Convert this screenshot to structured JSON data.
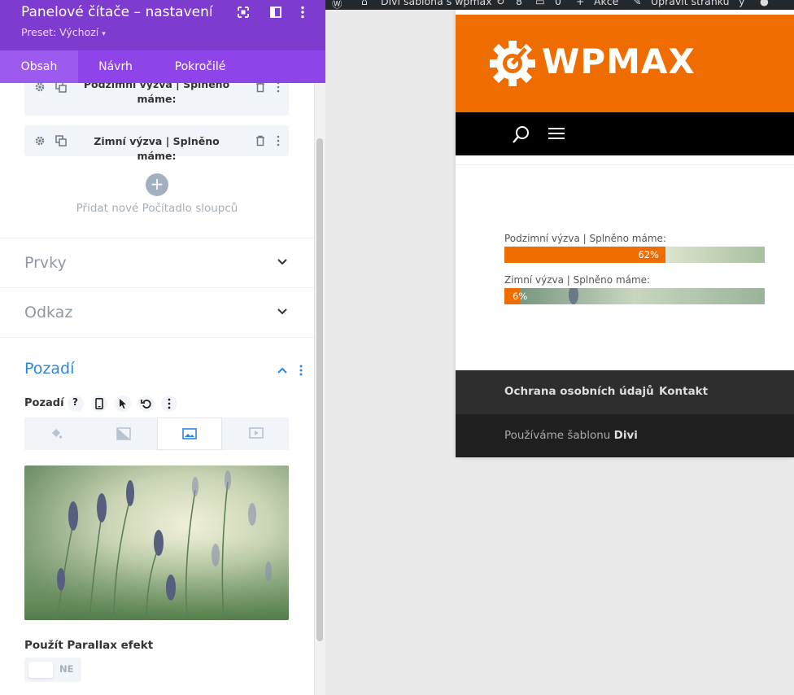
{
  "panel": {
    "title": "Panelové čítače – nastavení",
    "preset": "Preset: Výchozí",
    "tabs": [
      "Obsah",
      "Návrh",
      "Pokročilé"
    ],
    "items": [
      {
        "label": "Podzimní výzva | Splněno máme:"
      },
      {
        "label": "Zimní výzva | Splněno máme:"
      }
    ],
    "add_label": "Přidat nové Počítadlo sloupců",
    "sections": [
      "Prvky",
      "Odkaz"
    ],
    "background": {
      "title": "Pozadí",
      "label": "Pozadí",
      "help_icon": "question-icon",
      "parallax_label": "Použít Parallax efekt",
      "parallax_value": "NE"
    }
  },
  "adminbar": {
    "site_name": "Divi šablona s wpmax",
    "updates": "8",
    "comments": "0",
    "new_label": "Akce",
    "edit_label": "Upravit stránku"
  },
  "site": {
    "logo": "WPMAX",
    "counters": [
      {
        "title": "Podzimní výzva | Splněno máme:",
        "percent": 62,
        "percent_label": "62%"
      },
      {
        "title": "Zimní výzva | Splněno máme:",
        "percent": 6,
        "percent_label": "6%"
      }
    ],
    "footer_links": [
      "Ochrana osobních údajů",
      "Kontakt"
    ],
    "credit_prefix": "Používáme šablonu",
    "credit_theme": "Divi"
  },
  "colors": {
    "panel_purple": "#7d3bcf",
    "tab_purple": "#8e44e8",
    "accent_blue": "#2b87da",
    "brand_orange": "#ef6c00"
  }
}
